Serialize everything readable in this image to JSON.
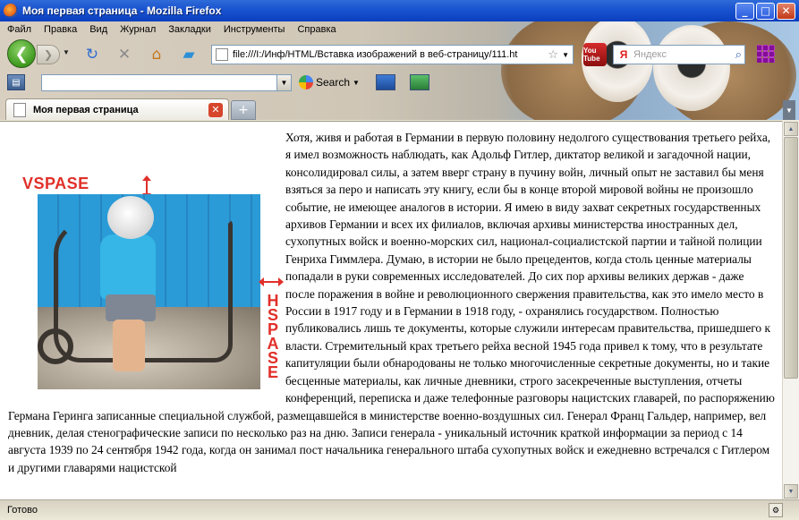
{
  "window": {
    "title": "Моя первая страница - Mozilla Firefox",
    "buttons": {
      "minimize": "_",
      "maximize": "□",
      "close": "✕"
    }
  },
  "menu": [
    "Файл",
    "Правка",
    "Вид",
    "Журнал",
    "Закладки",
    "Инструменты",
    "Справка"
  ],
  "navigation": {
    "url": "file:///I:/Инф/HTML/Вставка изображений в веб-страницу/111.ht",
    "search_engine_label": "Я",
    "search_placeholder": "Яндекс",
    "youtube_label": "You Tube"
  },
  "toolbar2": {
    "google_search_label": "Search"
  },
  "tabs": [
    {
      "label": "Моя первая страница",
      "active": true
    }
  ],
  "content": {
    "paragraph_start": "Хотя, живя и работая в Германии в первую половину недолгого существования третьего рейха, я имел возможность наблюдать, как Адольф Гитлер, диктатор великой и загадочной нации, консолидировал силы, а затем вверг страну в пучину войн, личный опыт не заставил бы меня взяться за перо и написать эту книгу, если бы в конце второй мировой войны не произошло событие, не имеющее аналогов в истории. Я имею в виду захват секретных государственных архивов Германии и всех их филиалов, включая архивы министерства иностранных дел, сухопутных войск и военно-морских сил, национал-социалистской партии и тайной полиции Генриха Гиммлера. Думаю, в истории не было прецедентов, когда столь ценные материалы попадали в руки современных исследователей. До сих пор архивы великих держав - даже после поражения в войне и революционного свержения правительства, как это имело место в России в 1917 году и в Германии в 1918 году, - охранялись государством. Полностью публиковались лишь те документы, которые служили интересам правительства, пришедшего к власти. Стремительный крах третьего рейха весной 1945 года привел к тому, что в результате капитуляции были обнародованы не только многочисленные секретные документы, но и такие бесценные материалы, как личные дневники, строго засекреченные выступления, отчеты конференций, переписка и даже телефонные разговоры нацистских главарей, по распоряжению Германа Геринга записанные специальной службой, размещавшейся в министерстве военно-воздушных сил. Генерал Франц Гальдер, например, вел дневник, делая стенографические записи по несколько раз на дню. Записи генерала - уникальный источник краткой информации за период с 14 августа 1939 по 24 сентября 1942 года, когда он занимал пост начальника генерального штаба сухопутных войск и ежедневно встречался с Гитлером и другими главарями нацистской",
    "annotation_vspace": "VSPASE",
    "annotation_hspace": "HSPASE"
  },
  "status": {
    "text": "Готово"
  },
  "colors": {
    "titlebar": "#0A3FBF",
    "annotation": "#E0302A",
    "content_bg": "#FFFFFF"
  }
}
